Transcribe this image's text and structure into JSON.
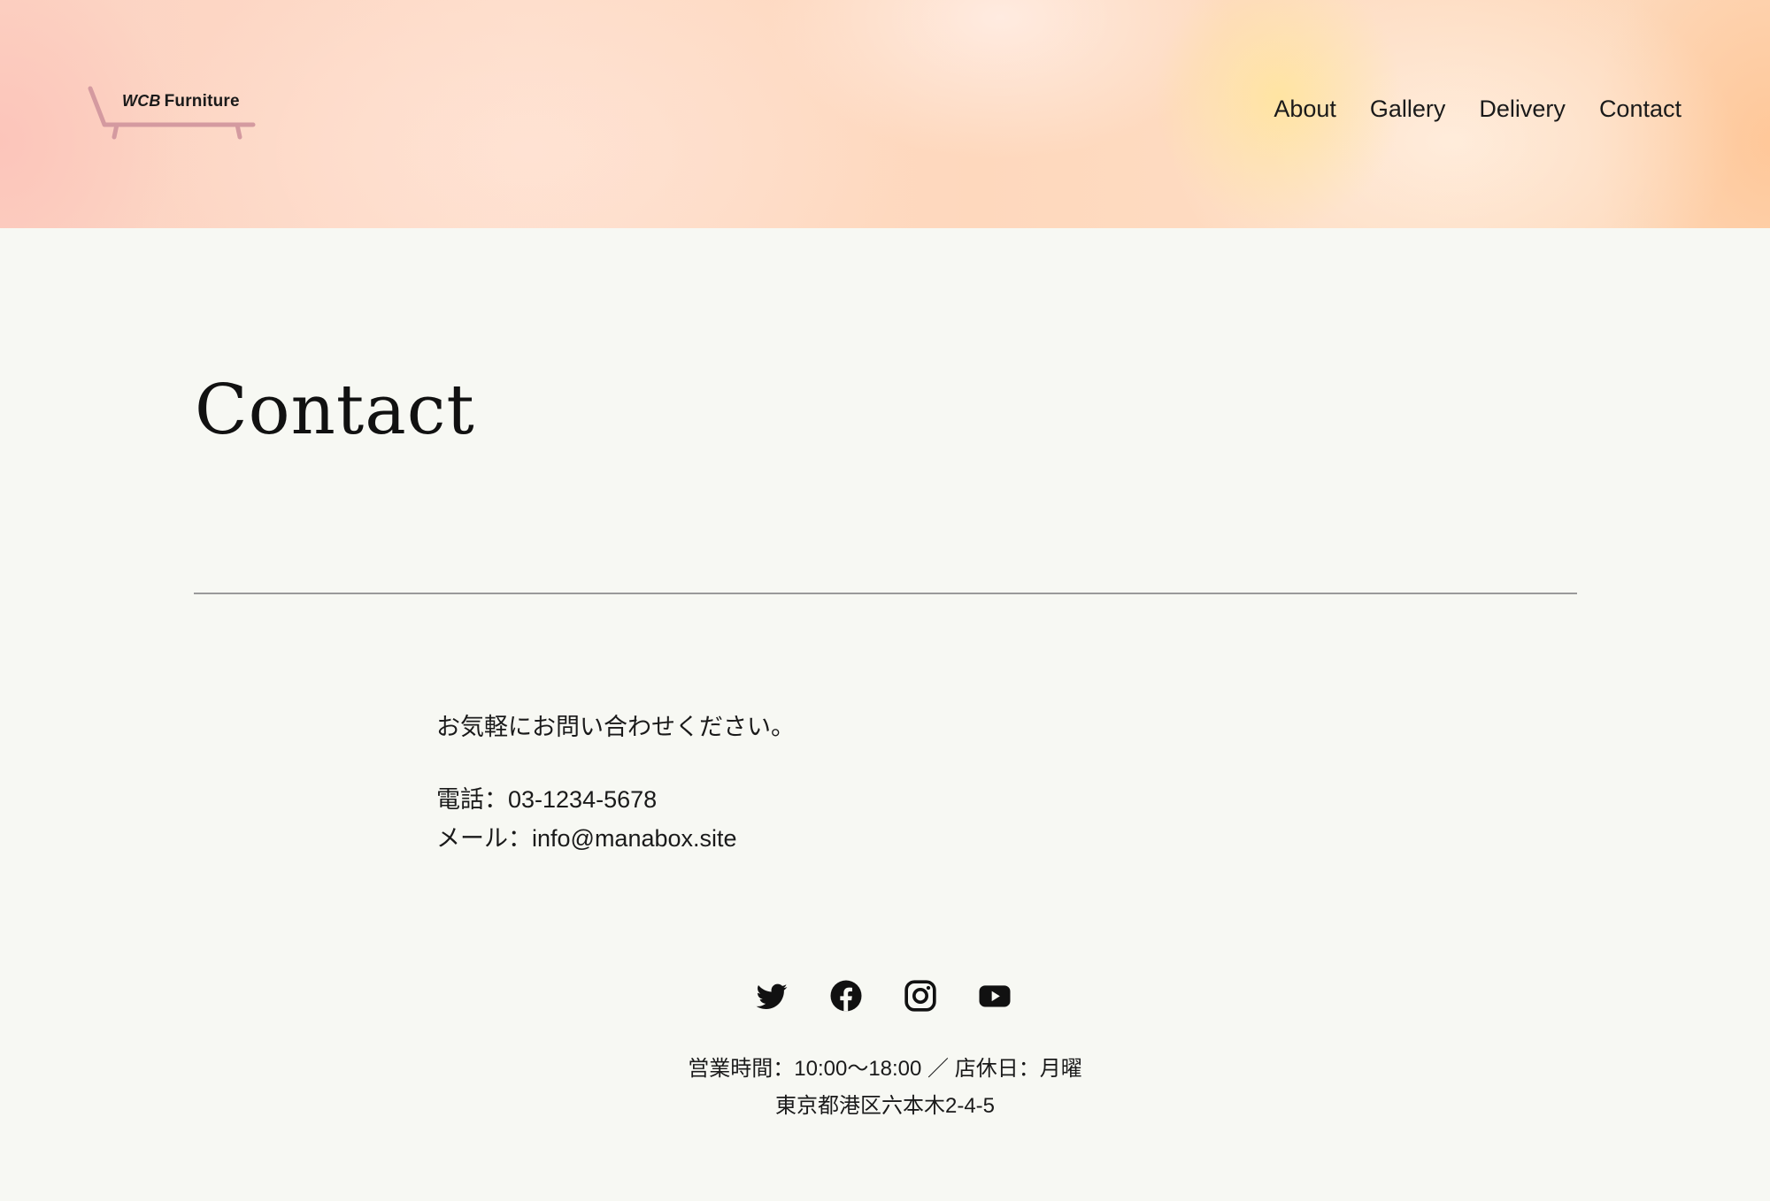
{
  "header": {
    "logo": {
      "brand_mark": "WCB",
      "brand_name": "Furniture"
    },
    "nav": [
      {
        "label": "About"
      },
      {
        "label": "Gallery"
      },
      {
        "label": "Delivery"
      },
      {
        "label": "Contact"
      }
    ]
  },
  "main": {
    "title": "Contact",
    "intro": "お気軽にお問い合わせください。",
    "phone": "電話：03-1234-5678",
    "email": "メール：info@manabox.site"
  },
  "footer": {
    "social": [
      {
        "icon": "twitter-icon"
      },
      {
        "icon": "facebook-icon"
      },
      {
        "icon": "instagram-icon"
      },
      {
        "icon": "youtube-icon"
      }
    ],
    "hours": "営業時間：10:00〜18:00 ／ 店休日：月曜",
    "address": "東京都港区六本木2-4-5"
  },
  "colors": {
    "background": "#f7f8f3",
    "logo_chair": "#d49aa0",
    "text": "#111111"
  }
}
